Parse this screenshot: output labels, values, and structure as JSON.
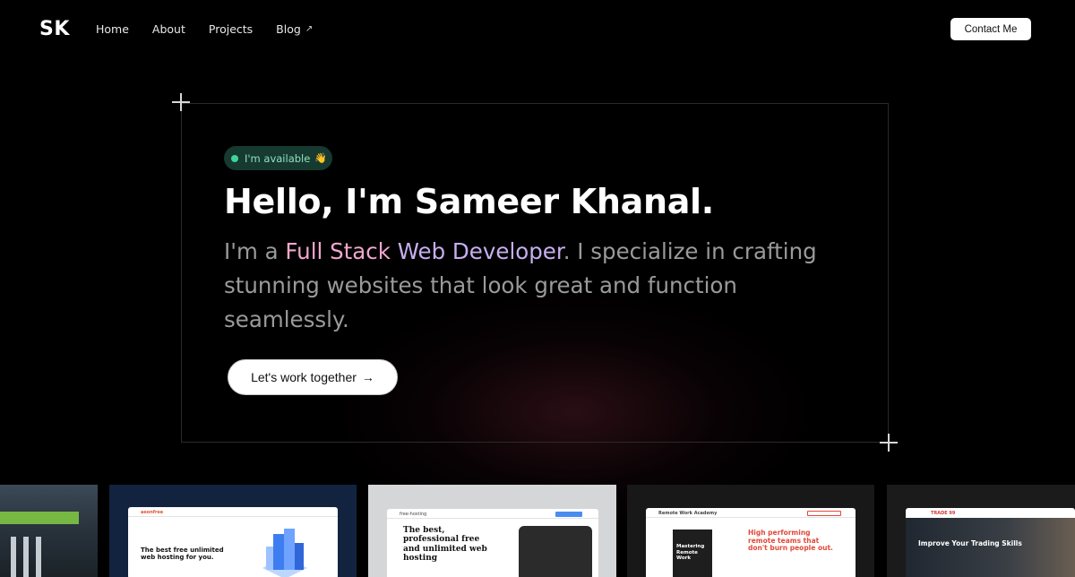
{
  "nav": {
    "logo": "SK",
    "links": [
      "Home",
      "About",
      "Projects",
      "Blog"
    ],
    "blog_external_icon": "↗",
    "contact_label": "Contact Me"
  },
  "hero": {
    "badge_text": "I'm available",
    "badge_emoji": "👋",
    "heading": "Hello, I'm Sameer Khanal.",
    "intro_prefix": "I'm a ",
    "intro_role_part1": "Full Stack",
    "intro_role_part2": " Web Developer",
    "intro_suffix": ". I specialize in crafting stunning websites that look great and function seamlessly.",
    "cta_label": "Let's work together",
    "cta_arrow": "→"
  },
  "projects": [
    {
      "name": "project-1"
    },
    {
      "name": "aeonfree",
      "brand": "aeonfree",
      "headline": "The best free unlimited web hosting for you."
    },
    {
      "name": "free-hosting",
      "brand": "free-hosting",
      "headline": "The best, professional free and unlimited web hosting"
    },
    {
      "name": "remote-work",
      "brand": "Remote Work Academy",
      "headline": "High performing remote teams that don't burn people out.",
      "box_text": "Mastering Remote Work"
    },
    {
      "name": "trade99",
      "brand": "TRADE 99",
      "headline": "Improve Your Trading Skills"
    }
  ],
  "colors": {
    "background": "#000000",
    "badge_bg": "#163a30",
    "badge_dot": "#3ed39a",
    "accent_pink": "#f0a6cc",
    "accent_purple": "#c7aef0",
    "muted_text": "#9a9a9a"
  }
}
